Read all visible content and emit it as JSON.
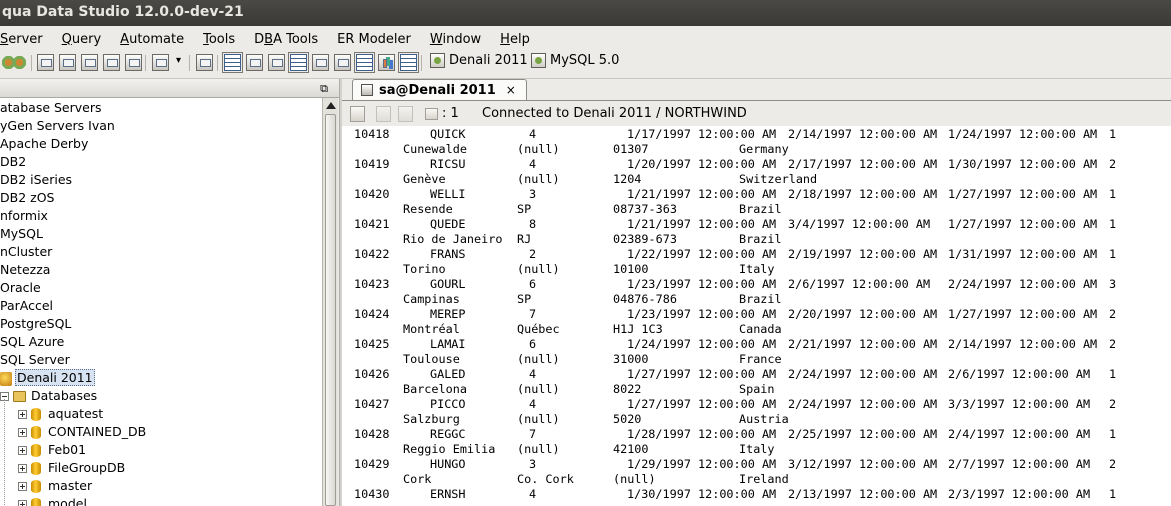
{
  "window": {
    "title": "qua Data Studio 12.0.0-dev-21"
  },
  "menu": [
    {
      "label": "Server",
      "mnemonic": "S"
    },
    {
      "label": "Query",
      "mnemonic": "Q"
    },
    {
      "label": "Automate",
      "mnemonic": "A"
    },
    {
      "label": "Tools",
      "mnemonic": "T"
    },
    {
      "label": "DBA Tools",
      "mnemonic": "B"
    },
    {
      "label": "ER Modeler",
      "mnemonic": ""
    },
    {
      "label": "Window",
      "mnemonic": "W"
    },
    {
      "label": "Help",
      "mnemonic": "H"
    }
  ],
  "toolbar": {
    "connections": [
      "Denali 2011",
      "MySQL 5.0"
    ],
    "dropdown_arrow": "▾"
  },
  "sidebar": {
    "maximize_glyph": "⧉",
    "servers": [
      "atabase Servers",
      "yGen Servers Ivan",
      "Apache Derby",
      "DB2",
      "DB2 iSeries",
      "DB2 zOS",
      "nformix",
      "MySQL",
      "nCluster",
      "Netezza",
      "Oracle",
      "ParAccel",
      "PostgreSQL",
      "SQL Azure",
      "SQL Server"
    ],
    "selected_server": "Denali 2011",
    "databases_folder": "Databases",
    "databases": [
      "aquatest",
      "CONTAINED_DB",
      "Feb01",
      "FileGroupDB",
      "master",
      "model"
    ]
  },
  "editor": {
    "tab_label": "sa@Denali 2011",
    "tab_close": "×",
    "row_count": ": 1",
    "status": "Connected to Denali 2011 / NORTHWIND"
  },
  "results": [
    {
      "order_id": "10418",
      "customer": "QUICK",
      "employee": "4",
      "order_date": "1/17/1997 12:00:00 AM",
      "required_date": "2/14/1997 12:00:00 AM",
      "shipped_date": "1/24/1997 12:00:00 AM",
      "ship_via": "1",
      "city": "Cunewalde",
      "region": "(null)",
      "postal": "01307",
      "country": "Germany"
    },
    {
      "order_id": "10419",
      "customer": "RICSU",
      "employee": "4",
      "order_date": "1/20/1997 12:00:00 AM",
      "required_date": "2/17/1997 12:00:00 AM",
      "shipped_date": "1/30/1997 12:00:00 AM",
      "ship_via": "2",
      "city": "Genève",
      "region": "(null)",
      "postal": "1204",
      "country": "Switzerland"
    },
    {
      "order_id": "10420",
      "customer": "WELLI",
      "employee": "3",
      "order_date": "1/21/1997 12:00:00 AM",
      "required_date": "2/18/1997 12:00:00 AM",
      "shipped_date": "1/27/1997 12:00:00 AM",
      "ship_via": "1",
      "city": "Resende",
      "region": "SP",
      "postal": "08737-363",
      "country": "Brazil"
    },
    {
      "order_id": "10421",
      "customer": "QUEDE",
      "employee": "8",
      "order_date": "1/21/1997 12:00:00 AM",
      "required_date": "3/4/1997 12:00:00 AM",
      "shipped_date": "1/27/1997 12:00:00 AM",
      "ship_via": "1",
      "city": "Rio de Janeiro",
      "region": "RJ",
      "postal": "02389-673",
      "country": "Brazil"
    },
    {
      "order_id": "10422",
      "customer": "FRANS",
      "employee": "2",
      "order_date": "1/22/1997 12:00:00 AM",
      "required_date": "2/19/1997 12:00:00 AM",
      "shipped_date": "1/31/1997 12:00:00 AM",
      "ship_via": "1",
      "city": "Torino",
      "region": "(null)",
      "postal": "10100",
      "country": "Italy"
    },
    {
      "order_id": "10423",
      "customer": "GOURL",
      "employee": "6",
      "order_date": "1/23/1997 12:00:00 AM",
      "required_date": "2/6/1997 12:00:00 AM",
      "shipped_date": "2/24/1997 12:00:00 AM",
      "ship_via": "3",
      "city": "Campinas",
      "region": "SP",
      "postal": "04876-786",
      "country": "Brazil"
    },
    {
      "order_id": "10424",
      "customer": "MEREP",
      "employee": "7",
      "order_date": "1/23/1997 12:00:00 AM",
      "required_date": "2/20/1997 12:00:00 AM",
      "shipped_date": "1/27/1997 12:00:00 AM",
      "ship_via": "2",
      "city": "Montréal",
      "region": "Québec",
      "postal": "H1J 1C3",
      "country": "Canada"
    },
    {
      "order_id": "10425",
      "customer": "LAMAI",
      "employee": "6",
      "order_date": "1/24/1997 12:00:00 AM",
      "required_date": "2/21/1997 12:00:00 AM",
      "shipped_date": "2/14/1997 12:00:00 AM",
      "ship_via": "2",
      "city": "Toulouse",
      "region": "(null)",
      "postal": "31000",
      "country": "France"
    },
    {
      "order_id": "10426",
      "customer": "GALED",
      "employee": "4",
      "order_date": "1/27/1997 12:00:00 AM",
      "required_date": "2/24/1997 12:00:00 AM",
      "shipped_date": "2/6/1997 12:00:00 AM",
      "ship_via": "1",
      "city": "Barcelona",
      "region": "(null)",
      "postal": "8022",
      "country": "Spain"
    },
    {
      "order_id": "10427",
      "customer": "PICCO",
      "employee": "4",
      "order_date": "1/27/1997 12:00:00 AM",
      "required_date": "2/24/1997 12:00:00 AM",
      "shipped_date": "3/3/1997 12:00:00 AM",
      "ship_via": "2",
      "city": "Salzburg",
      "region": "(null)",
      "postal": "5020",
      "country": "Austria"
    },
    {
      "order_id": "10428",
      "customer": "REGGC",
      "employee": "7",
      "order_date": "1/28/1997 12:00:00 AM",
      "required_date": "2/25/1997 12:00:00 AM",
      "shipped_date": "2/4/1997 12:00:00 AM",
      "ship_via": "1",
      "city": "Reggio Emilia",
      "region": "(null)",
      "postal": "42100",
      "country": "Italy"
    },
    {
      "order_id": "10429",
      "customer": "HUNGO",
      "employee": "3",
      "order_date": "1/29/1997 12:00:00 AM",
      "required_date": "3/12/1997 12:00:00 AM",
      "shipped_date": "2/7/1997 12:00:00 AM",
      "ship_via": "2",
      "city": "Cork",
      "region": "Co. Cork",
      "postal": "(null)",
      "country": "Ireland"
    },
    {
      "order_id": "10430",
      "customer": "ERNSH",
      "employee": "4",
      "order_date": "1/30/1997 12:00:00 AM",
      "required_date": "2/13/1997 12:00:00 AM",
      "shipped_date": "2/3/1997 12:00:00 AM",
      "ship_via": "1",
      "city": "",
      "region": "",
      "postal": "",
      "country": ""
    }
  ],
  "colors": {
    "titlebar": "#3a3935",
    "panel": "#ecebe8",
    "selection": "#d8e3f1"
  },
  "icons": [
    "new-connection-icon",
    "gear-icon",
    "query-window-icon",
    "grid-view-icon",
    "chart-view-icon",
    "copy-icon",
    "paste-icon",
    "grid-count-icon",
    "server-icon",
    "database-icon",
    "folder-icon"
  ]
}
